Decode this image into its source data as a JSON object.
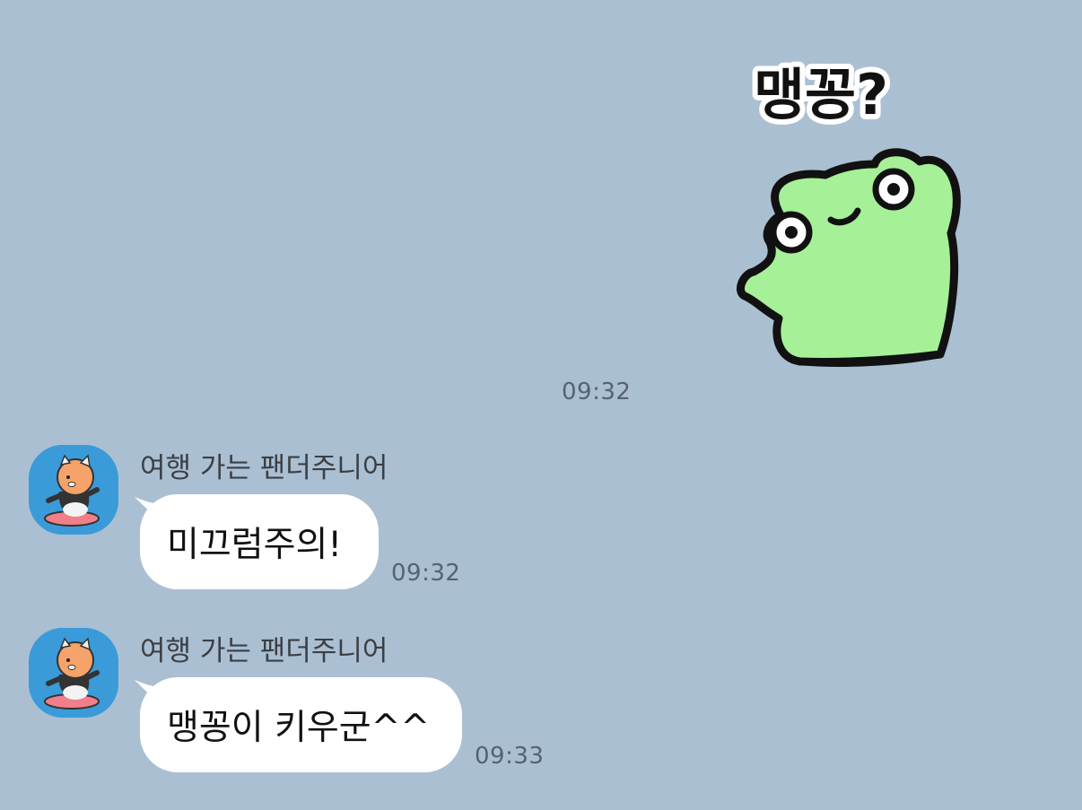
{
  "sticker": {
    "caption": "맹꽁?",
    "icon": "green-frog-sticker",
    "time": "09:32"
  },
  "messages": [
    {
      "sender": "여행 가는 팬더주니어",
      "text": "미끄럼주의!",
      "time": "09:32"
    },
    {
      "sender": "여행 가는 팬더주니어",
      "text": "맹꽁이 키우군^^",
      "time": "09:33"
    }
  ],
  "colors": {
    "background": "#abbfd2",
    "bubble": "#ffffff",
    "frog": "#a6f098",
    "avatar_bg": "#3a9bd8"
  }
}
